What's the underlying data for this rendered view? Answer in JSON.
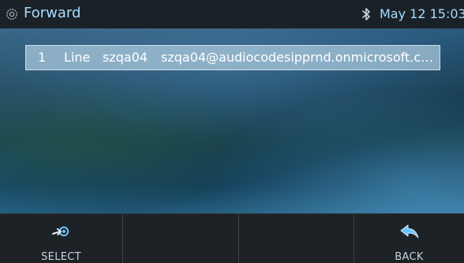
{
  "title_bar": {
    "title": "Forward",
    "datetime": "May 12 15:03",
    "icons": [
      "settings-icon",
      "bluetooth-icon"
    ]
  },
  "list": {
    "items": [
      {
        "index": "1",
        "type": "Line",
        "name": "szqa04",
        "address": "szqa04@audiocodesipprnd.onmicrosoft.co..."
      }
    ]
  },
  "softkeys": [
    {
      "label": "SELECT",
      "icon": "select-arrow-icon"
    },
    {
      "label": "",
      "icon": ""
    },
    {
      "label": "",
      "icon": ""
    },
    {
      "label": "BACK",
      "icon": "back-arrow-icon"
    }
  ],
  "colors": {
    "title_text": "#a8dcff",
    "icon_accent": "#6cc4ff",
    "softkey_bar": "#1d2227",
    "selected_row": "#afcde1"
  }
}
